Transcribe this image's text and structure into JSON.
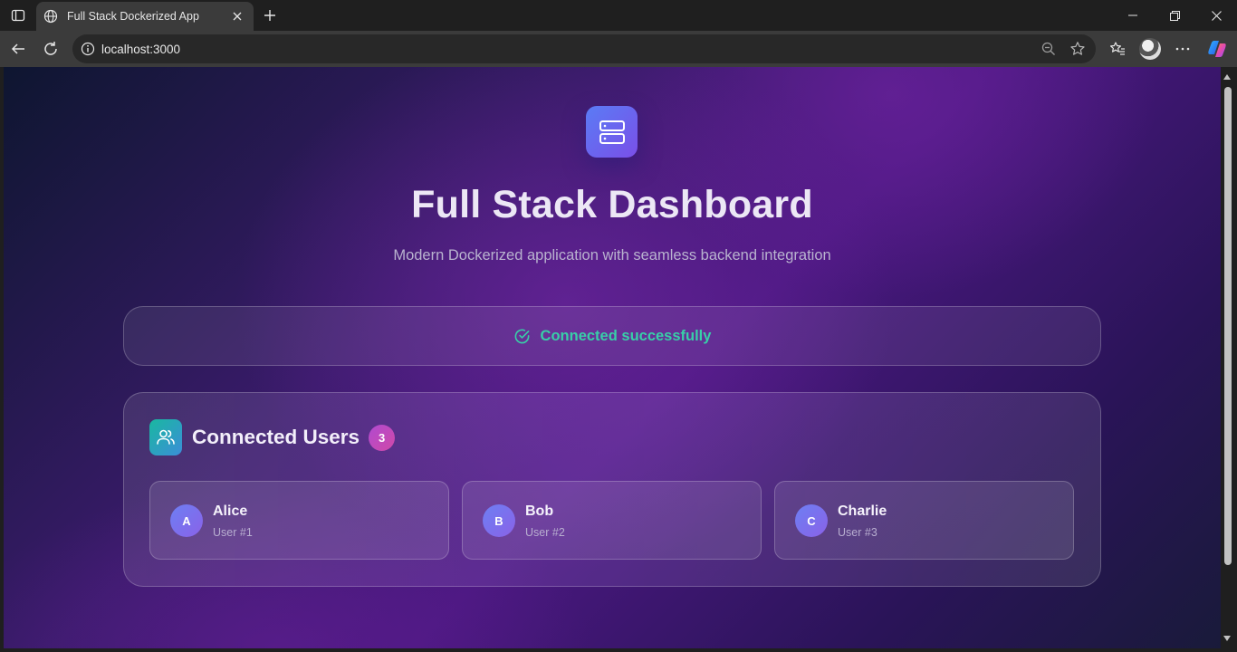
{
  "browser": {
    "tab_title": "Full Stack Dockerized App",
    "url": "localhost:3000"
  },
  "page": {
    "title": "Full Stack Dashboard",
    "subtitle": "Modern Dockerized application with seamless backend integration",
    "status": {
      "text": "Connected successfully",
      "color": "#38cfa8"
    },
    "users_section": {
      "title": "Connected Users",
      "count": "3",
      "users": [
        {
          "initial": "A",
          "name": "Alice",
          "sub": "User #1"
        },
        {
          "initial": "B",
          "name": "Bob",
          "sub": "User #2"
        },
        {
          "initial": "C",
          "name": "Charlie",
          "sub": "User #3"
        }
      ]
    }
  },
  "icons": {
    "tab": "globe-icon",
    "logo": "server-icon",
    "status": "check-circle-icon",
    "users": "users-icon"
  }
}
